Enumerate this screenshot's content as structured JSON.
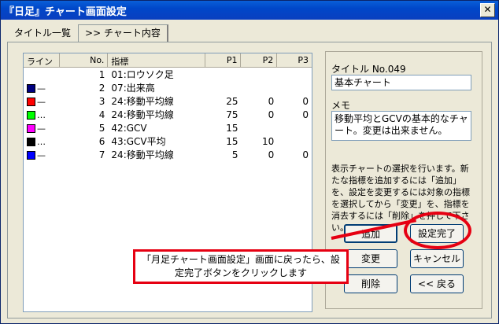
{
  "window": {
    "title": "『日足』チャート画面設定",
    "close_label": "✕"
  },
  "tabs": [
    {
      "label": "タイトル一覧"
    },
    {
      "label": ">> チャート内容"
    }
  ],
  "list": {
    "headers": {
      "line": "ライン",
      "no": "No.",
      "name": "指標",
      "p1": "P1",
      "p2": "P2",
      "p3": "P3"
    },
    "rows": [
      {
        "color": "",
        "style": "",
        "no": "1",
        "name": "01:ロウソク足",
        "p1": "",
        "p2": "",
        "p3": ""
      },
      {
        "color": "#000080",
        "style": "—",
        "no": "2",
        "name": "07:出来高",
        "p1": "",
        "p2": "",
        "p3": ""
      },
      {
        "color": "#ff0000",
        "style": "—",
        "no": "3",
        "name": "24:移動平均線",
        "p1": "25",
        "p2": "0",
        "p3": "0"
      },
      {
        "color": "#00ff00",
        "style": "…",
        "no": "4",
        "name": "24:移動平均線",
        "p1": "75",
        "p2": "0",
        "p3": "0"
      },
      {
        "color": "#ff00ff",
        "style": "—",
        "no": "5",
        "name": "42:GCV",
        "p1": "15",
        "p2": "",
        "p3": ""
      },
      {
        "color": "#000000",
        "style": "…",
        "no": "6",
        "name": "43:GCV平均",
        "p1": "15",
        "p2": "10",
        "p3": ""
      },
      {
        "color": "#0000ff",
        "style": "—",
        "no": "7",
        "name": "24:移動平均線",
        "p1": "5",
        "p2": "0",
        "p3": "0"
      }
    ]
  },
  "title_field": {
    "label": "タイトル No.049",
    "value": "基本チャート"
  },
  "memo_field": {
    "label": "メモ",
    "value": "移動平均とGCVの基本的なチャート。変更は出来ません。"
  },
  "help_text": "表示チャートの選択を行います。新たな指標を追加するには「追加」を、設定を変更するには対象の指標を選択してから「変更」を、指標を消去するには「削除」を押して下さい。",
  "buttons": {
    "add": "追加",
    "complete": "設定完了",
    "change": "変更",
    "cancel": "キャンセル",
    "delete": "削除",
    "back": "<< 戻る"
  },
  "callout": {
    "text": "「月足チャート画面設定」画面に戻ったら、設定完了ボタンをクリックします"
  },
  "colors": {
    "highlight": "#e60012",
    "titlebar": "#0a5fd8"
  }
}
